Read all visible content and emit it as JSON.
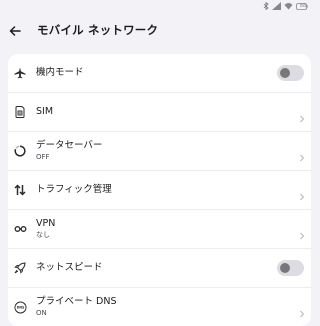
{
  "status_bar": {
    "battery_label": "88"
  },
  "header": {
    "title": "モバイル ネットワーク"
  },
  "settings": {
    "airplane_mode": {
      "label": "機内モード",
      "enabled": false
    },
    "sim": {
      "label": "SIM"
    },
    "data_saver": {
      "label": "データセーバー",
      "status": "OFF"
    },
    "traffic": {
      "label": "トラフィック管理"
    },
    "vpn": {
      "label": "VPN",
      "status": "なし"
    },
    "net_speed": {
      "label": "ネットスピード",
      "enabled": false
    },
    "private_dns": {
      "label": "プライベート DNS",
      "status": "ON"
    }
  }
}
